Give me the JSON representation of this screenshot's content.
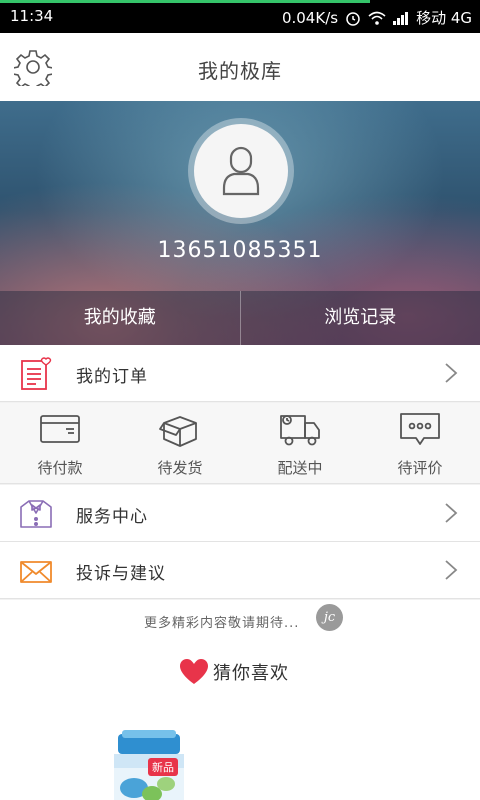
{
  "status_bar": {
    "time": "11:34",
    "speed": "0.04K/s",
    "carrier": "移动 4G"
  },
  "header": {
    "title": "我的极库",
    "settings_icon": "gear-icon"
  },
  "profile": {
    "phone": "13651085351",
    "avatar_icon": "user-icon",
    "tabs": [
      "我的收藏",
      "浏览记录"
    ]
  },
  "orders": {
    "label": "我的订单",
    "icon": "order-list-icon",
    "statuses": [
      {
        "label": "待付款",
        "icon": "card-icon"
      },
      {
        "label": "待发货",
        "icon": "box-icon"
      },
      {
        "label": "配送中",
        "icon": "truck-icon"
      },
      {
        "label": "待评价",
        "icon": "comment-icon"
      }
    ]
  },
  "menu": [
    {
      "label": "服务中心",
      "icon": "service-icon"
    },
    {
      "label": "投诉与建议",
      "icon": "mail-icon"
    }
  ],
  "more_text": "更多精彩内容敬请期待...",
  "logo_text": "jc",
  "guess": {
    "title": "猜你喜欢",
    "product_tag": "新品"
  },
  "colors": {
    "accent_red": "#e8344a",
    "status_green": "#35c46a"
  }
}
